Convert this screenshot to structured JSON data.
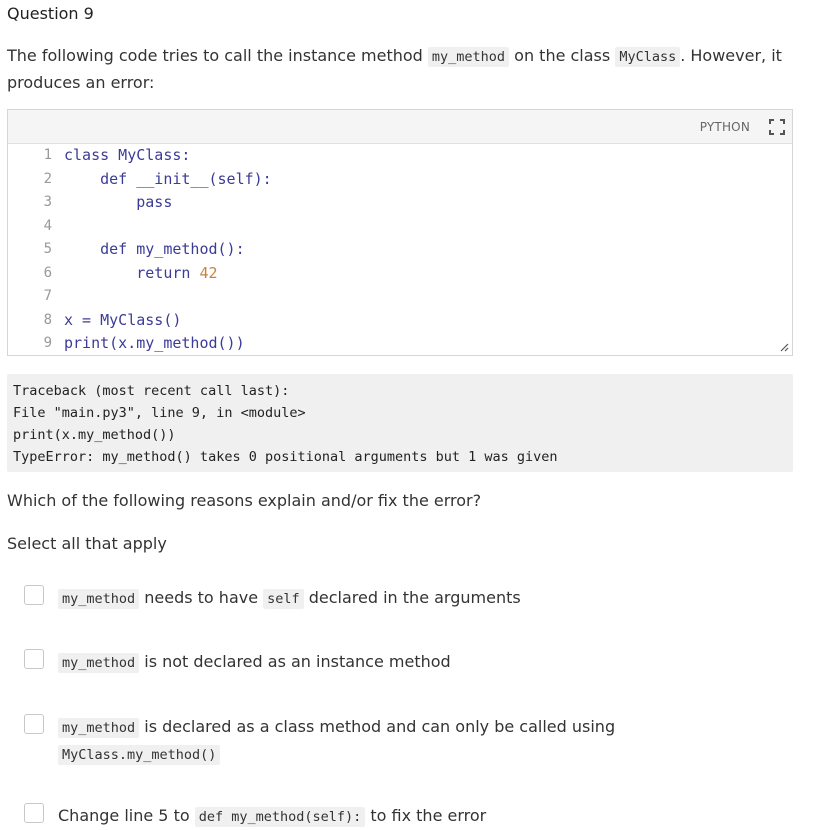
{
  "question": {
    "title": "Question 9",
    "prompt_part1": "The following code tries to call the instance method ",
    "prompt_code1": "my_method",
    "prompt_part2": " on the class ",
    "prompt_code2": "MyClass",
    "prompt_part3": ". However, it produces an error:"
  },
  "editor": {
    "language": "PYTHON",
    "lines": [
      {
        "n": "1",
        "text": "class MyClass:"
      },
      {
        "n": "2",
        "text": "    def __init__(self):"
      },
      {
        "n": "3",
        "text": "        pass"
      },
      {
        "n": "4",
        "text": ""
      },
      {
        "n": "5",
        "text": "    def my_method():"
      },
      {
        "n": "6",
        "text": "        return 42"
      },
      {
        "n": "7",
        "text": ""
      },
      {
        "n": "8",
        "text": "x = MyClass()"
      },
      {
        "n": "9",
        "text": "print(x.my_method())"
      }
    ]
  },
  "traceback": [
    "Traceback (most recent call last):",
    "File \"main.py3\", line 9, in <module>",
    "print(x.my_method())",
    "TypeError: my_method() takes 0 positional arguments but 1 was given"
  ],
  "ask": "Which of the following reasons explain and/or fix the error?",
  "instruction": "Select all that apply",
  "options": [
    {
      "code": "my_method",
      "text": " needs to have ",
      "code2": "self",
      "text2": " declared in the arguments"
    },
    {
      "code": "my_method",
      "text": " is not declared as an instance method"
    },
    {
      "code": "my_method",
      "text": " is declared as a class method and can only be called using ",
      "code2": "MyClass.my_method()"
    },
    {
      "pre": "Change line 5 to ",
      "code": "def my_method(self):",
      "text": " to fix the error"
    }
  ]
}
